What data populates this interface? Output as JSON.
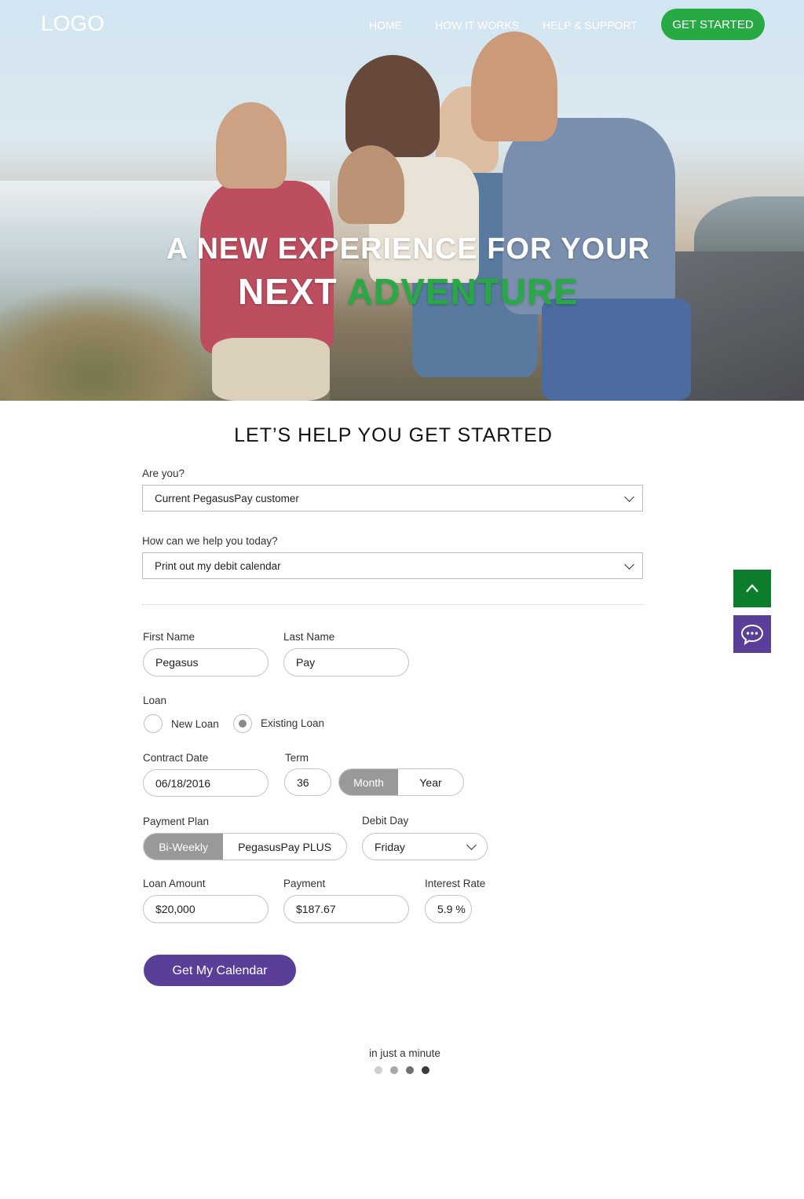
{
  "nav": {
    "logo": "LOGO",
    "links": [
      "HOME",
      "HOW IT WORKS",
      "HELP & SUPPORT"
    ],
    "cta": "GET STARTED"
  },
  "hero": {
    "line1": "A NEW EXPERIENCE FOR YOUR",
    "line2_white": "NEXT",
    "line2_accent": "ADVENTURE"
  },
  "form": {
    "title": "LET’S HELP YOU GET STARTED",
    "are_you": {
      "label": "Are you?",
      "value": "Current PegasusPay customer"
    },
    "help_today": {
      "label": "How can we help you today?",
      "value": "Print out my debit calendar"
    },
    "first_name": {
      "label": "First Name",
      "value": "Pegasus"
    },
    "last_name": {
      "label": "Last Name",
      "value": "Pay"
    },
    "loan": {
      "label": "Loan",
      "options": [
        "New Loan",
        "Existing Loan"
      ],
      "selected": "Existing Loan"
    },
    "contract_date": {
      "label": "Contract Date",
      "value": "06/18/2016"
    },
    "term": {
      "label": "Term",
      "value": "36",
      "units": [
        "Month",
        "Year"
      ],
      "selected": "Month"
    },
    "payment_plan": {
      "label": "Payment Plan",
      "options": [
        "Bi-Weekly",
        "PegasusPay PLUS"
      ],
      "selected": "Bi-Weekly"
    },
    "debit_day": {
      "label": "Debit Day",
      "value": "Friday"
    },
    "loan_amount": {
      "label": "Loan Amount",
      "value": "$20,000"
    },
    "payment": {
      "label": "Payment",
      "value": "$187.67"
    },
    "interest_rate": {
      "label": "Interest Rate",
      "value": "5.9 %"
    },
    "submit": "Get My Calendar"
  },
  "footer": {
    "hint": "in just a minute",
    "progress": {
      "steps": 4,
      "current": 4
    }
  },
  "colors": {
    "green": "#27a944",
    "dark_green": "#0b7d2b",
    "purple": "#5a3e98",
    "segment_active": "#999999"
  },
  "icons": {
    "scroll_top": "chevron-up-icon",
    "chat": "chat-bubble-icon"
  }
}
